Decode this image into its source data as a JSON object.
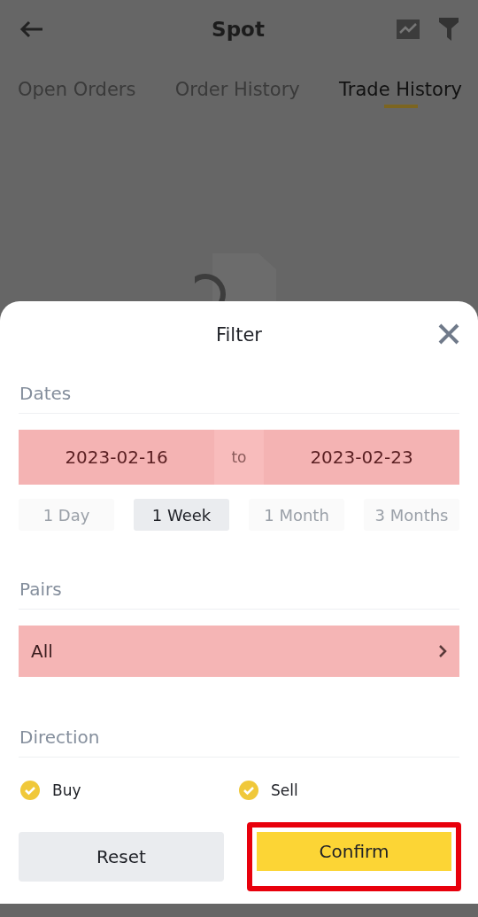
{
  "header": {
    "title": "Spot"
  },
  "tabs": [
    {
      "label": "Open Orders",
      "selected": false
    },
    {
      "label": "Order History",
      "selected": false
    },
    {
      "label": "Trade History",
      "selected": true
    }
  ],
  "filter": {
    "title": "Filter",
    "dates": {
      "label": "Dates",
      "from": "2023-02-16",
      "separator": "to",
      "to": "2023-02-23"
    },
    "presets": [
      {
        "label": "1 Day",
        "selected": false
      },
      {
        "label": "1 Week",
        "selected": true
      },
      {
        "label": "1 Month",
        "selected": false
      },
      {
        "label": "3 Months",
        "selected": false
      }
    ],
    "pairs": {
      "label": "Pairs",
      "value": "All"
    },
    "direction": {
      "label": "Direction",
      "options": [
        {
          "label": "Buy",
          "checked": true
        },
        {
          "label": "Sell",
          "checked": true
        }
      ]
    },
    "buttons": {
      "reset": "Reset",
      "confirm": "Confirm"
    }
  }
}
